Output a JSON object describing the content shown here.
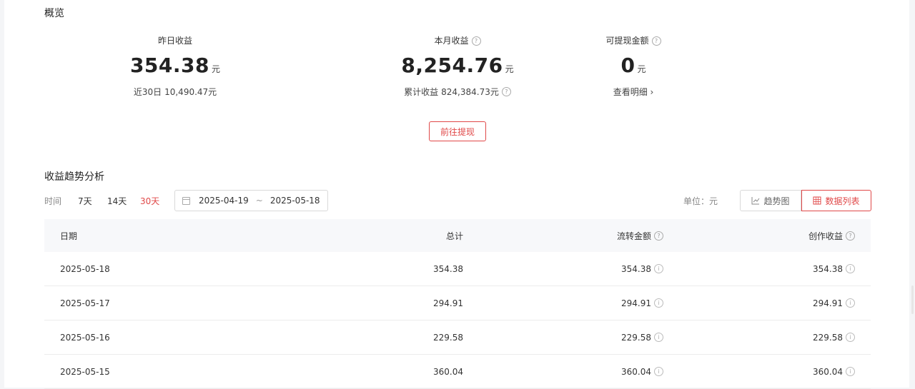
{
  "overview": {
    "title": "概览",
    "yesterday": {
      "label": "昨日收益",
      "value": "354.38",
      "unit": "元",
      "sub_label": "近30日",
      "sub_value": "10,490.47元"
    },
    "month": {
      "label": "本月收益",
      "value": "8,254.76",
      "unit": "元",
      "sub_label": "累计收益",
      "sub_value": "824,384.73元"
    },
    "withdrawable": {
      "label": "可提现金额",
      "value": "0",
      "unit": "元",
      "link": "查看明细 ›"
    },
    "withdraw_button": "前往提现"
  },
  "trend": {
    "title": "收益趋势分析",
    "time_label": "时间",
    "ranges": [
      "7天",
      "14天",
      "30天"
    ],
    "active_range": "30天",
    "date_start": "2025-04-19",
    "date_sep": "~",
    "date_end": "2025-05-18",
    "unit_label": "单位：元",
    "view_chart": "趋势图",
    "view_list": "数据列表"
  },
  "table": {
    "headers": {
      "date": "日期",
      "total": "总计",
      "flow": "流转金额",
      "create": "创作收益"
    },
    "rows": [
      {
        "date": "2025-05-18",
        "total": "354.38",
        "flow": "354.38",
        "create": "354.38"
      },
      {
        "date": "2025-05-17",
        "total": "294.91",
        "flow": "294.91",
        "create": "294.91"
      },
      {
        "date": "2025-05-16",
        "total": "229.58",
        "flow": "229.58",
        "create": "229.58"
      },
      {
        "date": "2025-05-15",
        "total": "360.04",
        "flow": "360.04",
        "create": "360.04"
      }
    ]
  },
  "colors": {
    "accent": "#e04848",
    "header_bg": "#f7f8fa"
  },
  "icons": [
    "help-icon",
    "info-icon",
    "calendar-icon",
    "line-chart-icon",
    "table-icon",
    "chevron-right-icon"
  ]
}
